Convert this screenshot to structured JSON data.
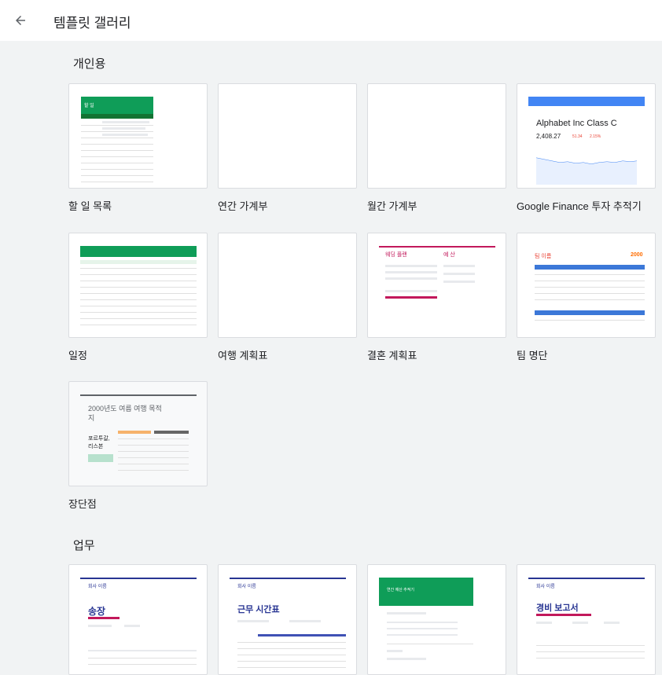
{
  "header": {
    "title": "템플릿 갤러리"
  },
  "sections": [
    {
      "title": "개인용"
    },
    {
      "title": "업무"
    }
  ],
  "templates": {
    "todo": {
      "label": "할 일 목록",
      "thumb_title": "할 일"
    },
    "annual_budget": {
      "label": "연간 가계부"
    },
    "monthly_budget": {
      "label": "월간 가계부"
    },
    "finance": {
      "label": "Google Finance 투자 추적기",
      "thumb_title": "Alphabet Inc Class C",
      "thumb_price": "2,408.27",
      "thumb_change1": "51.34",
      "thumb_change2": "2.15%"
    },
    "schedule": {
      "label": "일정"
    },
    "travel": {
      "label": "여행 계획표"
    },
    "wedding": {
      "label": "결혼 계획표",
      "thumb_title": "웨딩 플랜",
      "thumb_side": "예 산"
    },
    "team": {
      "label": "팀 명단",
      "thumb_title": "팀 이름",
      "thumb_year": "2000"
    },
    "pros_cons": {
      "label": "장단점",
      "thumb_title": "2000년도 여름 여행 목적지",
      "thumb_place": "포르투갈, 리스본"
    },
    "invoice": {
      "thumb_company": "회사 이름",
      "thumb_title": "송장"
    },
    "timesheet": {
      "thumb_company": "회사 이름",
      "thumb_title": "근무 시간표"
    },
    "project": {
      "thumb_title": "연간 예산 추적기"
    },
    "expense": {
      "thumb_company": "회사 이름",
      "thumb_title": "경비 보고서"
    }
  },
  "colors": {
    "green": "#0f9d58",
    "blue": "#4285f4",
    "magenta": "#c2185b",
    "orange": "#ff6d01",
    "navy": "#283593"
  }
}
